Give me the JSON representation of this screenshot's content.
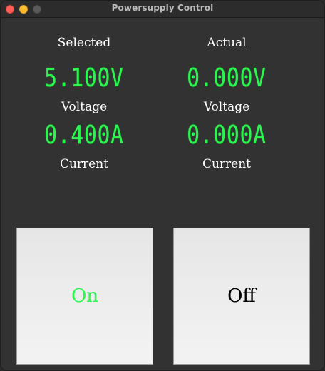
{
  "window": {
    "title": "Powersupply Control"
  },
  "columns": {
    "selected_header": "Selected",
    "actual_header": "Actual"
  },
  "selected": {
    "voltage": "5.100V",
    "voltage_label": "Voltage",
    "current": "0.400A",
    "current_label": "Current"
  },
  "actual": {
    "voltage": "0.000V",
    "voltage_label": "Voltage",
    "current": "0.000A",
    "current_label": "Current"
  },
  "buttons": {
    "on_label": "On",
    "off_label": "Off"
  },
  "colors": {
    "lcd_green": "#2bf54f",
    "window_background": "#323232",
    "button_background": "#ececec"
  }
}
